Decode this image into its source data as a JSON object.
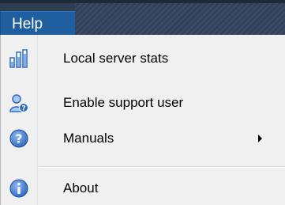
{
  "menubar": {
    "title": "Help"
  },
  "menu": {
    "items": [
      {
        "label": "Local server stats",
        "icon": "bar-chart-icon",
        "has_submenu": false
      },
      {
        "label": "Enable support user",
        "icon": "user-help-icon",
        "has_submenu": false
      },
      {
        "label": "Manuals",
        "icon": "question-icon",
        "has_submenu": true
      },
      {
        "label": "About",
        "icon": "info-icon",
        "has_submenu": false
      }
    ]
  },
  "colors": {
    "menubar_bg": "#2e3d52",
    "menu_title_bg": "#1f5fa0",
    "menu_bg": "#f0f0f0",
    "icon_blue": "#3a78c9"
  }
}
